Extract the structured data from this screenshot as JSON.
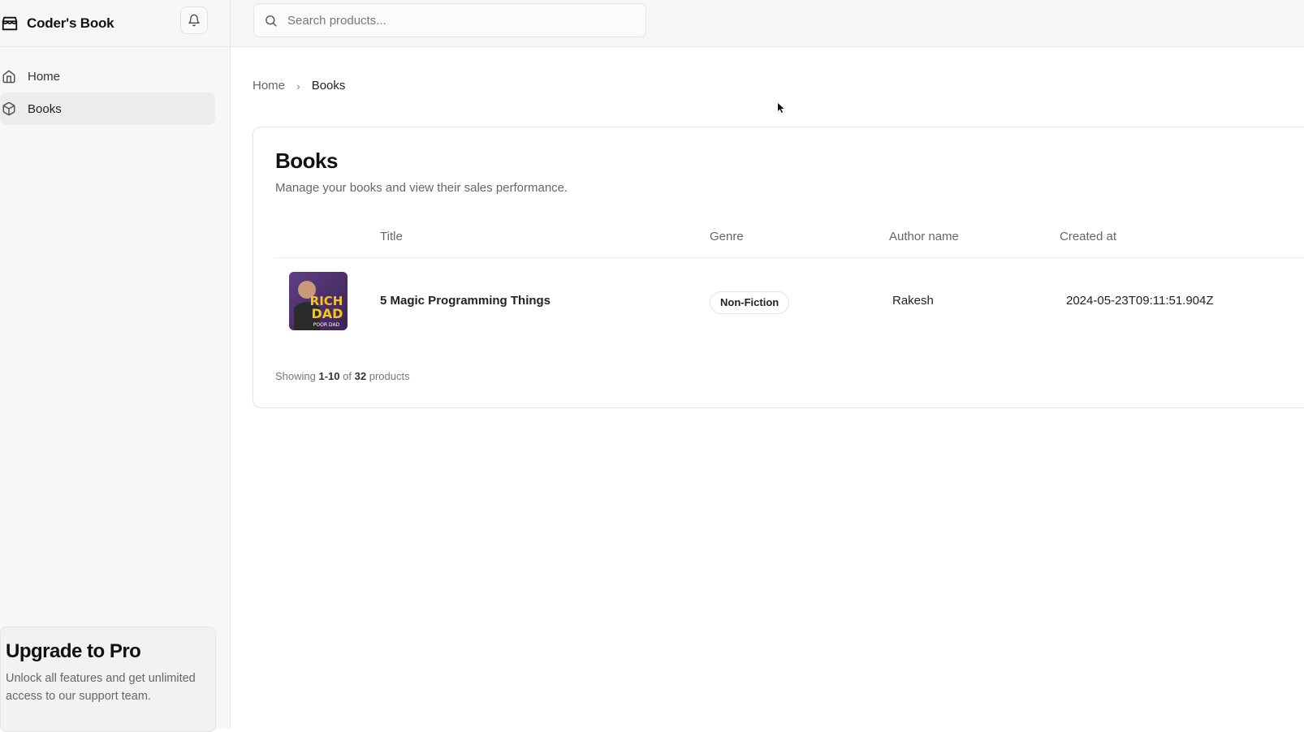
{
  "app": {
    "name": "Coder's Book"
  },
  "sidebar": {
    "items": [
      {
        "label": "Home",
        "icon": "home-icon"
      },
      {
        "label": "Books",
        "icon": "package-icon",
        "active": true
      }
    ],
    "upgrade": {
      "title": "Upgrade to Pro",
      "text": "Unlock all features and get unlimited access to our support team."
    }
  },
  "search": {
    "placeholder": "Search products..."
  },
  "breadcrumb": {
    "home": "Home",
    "separator": "›",
    "current": "Books"
  },
  "page": {
    "title": "Books",
    "subtitle": "Manage your books and view their sales performance."
  },
  "table": {
    "columns": [
      "Title",
      "Genre",
      "Author name",
      "Created at"
    ],
    "rows": [
      {
        "cover_text_1": "RICH",
        "cover_text_2": "DAD",
        "cover_text_3": "POOR DAD",
        "title": "5 Magic Programming Things",
        "genre": "Non-Fiction",
        "author": "Rakesh",
        "created_at": "2024-05-23T09:11:51.904Z"
      }
    ]
  },
  "pagination": {
    "prefix": "Showing",
    "range": "1-10",
    "of": "of",
    "total": "32",
    "suffix": "products"
  },
  "colors": {
    "sidebar_bg": "#f7f7f7",
    "active_item_bg": "#ececec",
    "cover_bg": "#4b2f6b",
    "cover_text": "#f5c518"
  }
}
